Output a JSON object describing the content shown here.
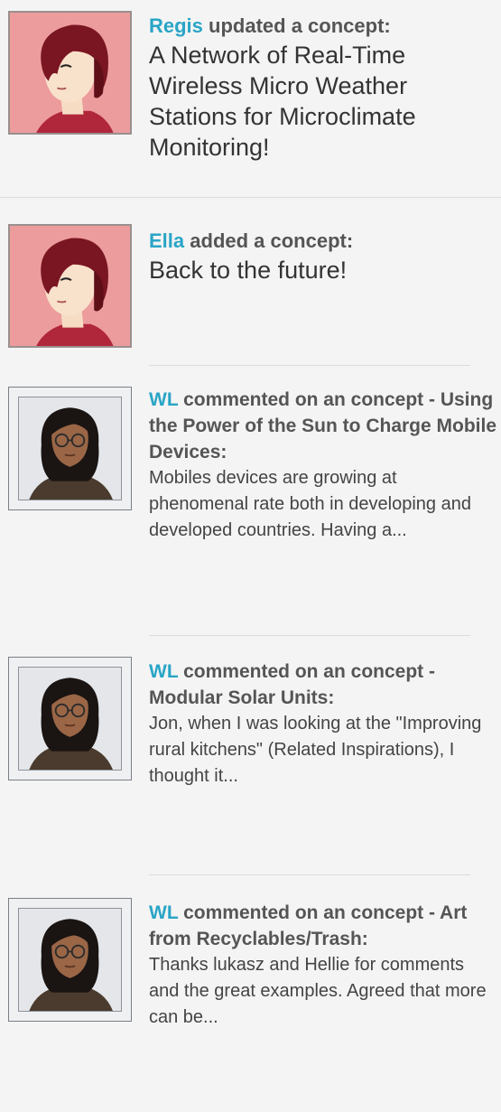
{
  "feed": {
    "items": [
      {
        "user": "Regis",
        "action": "updated a concept:",
        "title": "A Network of Real-Time Wireless Micro Weather Stations for Microclimate Monitoring!",
        "avatar": "cartoon-person-avatar"
      },
      {
        "user": "Ella",
        "action": "added a concept:",
        "title": "Back to the future!",
        "avatar": "cartoon-person-avatar"
      },
      {
        "user": "WL",
        "action": "commented on an concept - Using the Power of the Sun to Charge Mobile Devices:",
        "excerpt": "Mobiles devices are growing at phenomenal rate both in developing and developed countries. Having a...",
        "avatar": "3d-person-avatar"
      },
      {
        "user": "WL",
        "action": "commented on an concept - Modular Solar Units:",
        "excerpt": "Jon, when I was looking at the \"Improving rural kitchens\" (Related Inspirations), I thought it...",
        "avatar": "3d-person-avatar"
      },
      {
        "user": "WL",
        "action": "commented on an concept - Art from Recyclables/Trash:",
        "excerpt": "Thanks lukasz and Hellie for comments and the great examples. Agreed that more can be...",
        "avatar": "3d-person-avatar"
      }
    ]
  },
  "colors": {
    "username": "#29a5c6",
    "background": "#f4f4f4",
    "cartoon_avatar_bg": "#e99a9a",
    "divider": "#dcdcdc"
  }
}
